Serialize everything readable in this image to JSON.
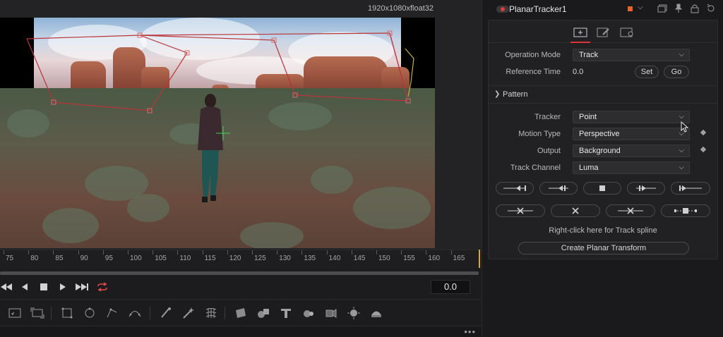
{
  "viewer": {
    "format_label": "1920x1080xfloat32"
  },
  "timeline": {
    "ticks": [
      "75",
      "80",
      "85",
      "90",
      "95",
      "100",
      "105",
      "110",
      "115",
      "120",
      "125",
      "130",
      "135",
      "140",
      "145",
      "150",
      "155",
      "160",
      "165"
    ],
    "current_frame": "0.0"
  },
  "transport": {
    "rewind_icon": "rewind-icon",
    "step_back_icon": "step-back-icon",
    "stop_icon": "stop-icon",
    "play_icon": "play-icon",
    "fast_forward_icon": "fast-forward-icon",
    "loop_icon": "loop-icon"
  },
  "inspector": {
    "node_title": "PlanarTracker1",
    "node_color": "#e6642c",
    "operation_mode": {
      "label": "Operation Mode",
      "value": "Track"
    },
    "reference_time": {
      "label": "Reference Time",
      "value": "0.0",
      "set_label": "Set",
      "go_label": "Go"
    },
    "pattern_section": "Pattern",
    "tracker": {
      "label": "Tracker",
      "value": "Point"
    },
    "motion_type": {
      "label": "Motion Type",
      "value": "Perspective"
    },
    "output": {
      "label": "Output",
      "value": "Background"
    },
    "track_channel": {
      "label": "Track Channel",
      "value": "Luma"
    },
    "hint": "Right-click here for Track spline",
    "create_button": "Create Planar Transform"
  },
  "colors": {
    "accent_red": "#d8343a",
    "playhead": "#e0a531",
    "loop_icon": "#e54848"
  }
}
